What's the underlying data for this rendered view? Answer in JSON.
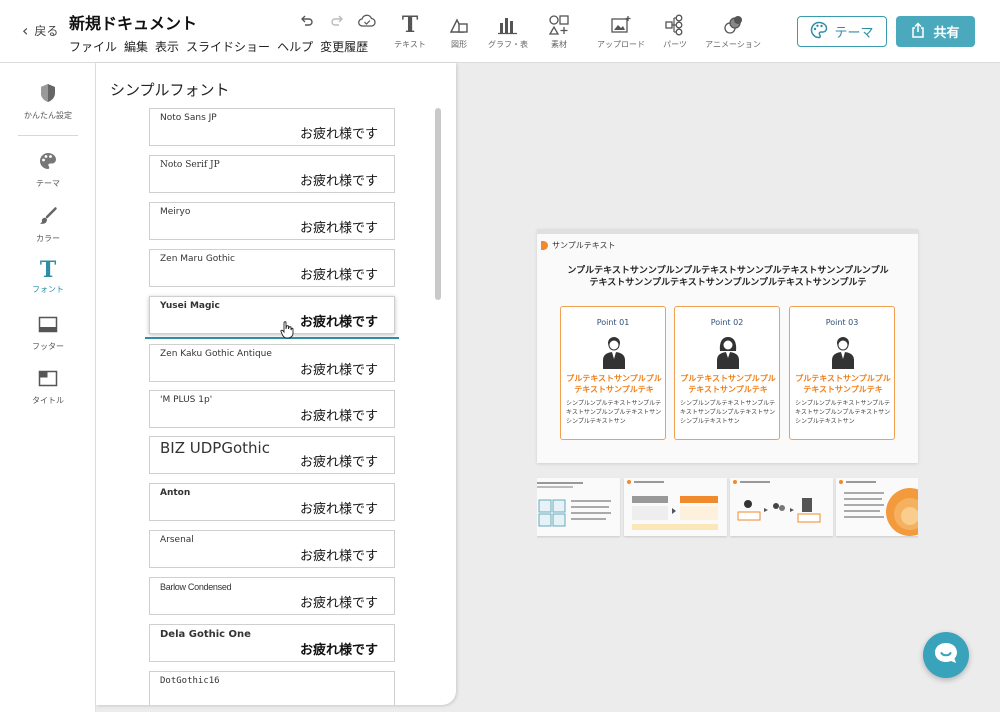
{
  "header": {
    "back_label": "戻る",
    "doc_title": "新規ドキュメント",
    "menu": [
      "ファイル",
      "編集",
      "表示",
      "スライドショー",
      "ヘルプ",
      "変更履歴"
    ],
    "tools": [
      {
        "label": "テキスト",
        "icon": "text-icon"
      },
      {
        "label": "図形",
        "icon": "shapes-icon"
      },
      {
        "label": "グラフ・表",
        "icon": "chart-icon"
      },
      {
        "label": "素材",
        "icon": "assets-icon"
      },
      {
        "label": "アップロード",
        "icon": "upload-icon"
      },
      {
        "label": "パーツ",
        "icon": "parts-icon"
      },
      {
        "label": "アニメーション",
        "icon": "animation-icon"
      }
    ],
    "theme_button": "テーマ",
    "share_button": "共有"
  },
  "sidebar": {
    "items": [
      {
        "label": "かんたん設定",
        "icon": "shield-icon"
      },
      {
        "label": "テーマ",
        "icon": "palette-icon"
      },
      {
        "label": "カラー",
        "icon": "brush-icon"
      },
      {
        "label": "フォント",
        "icon": "font-icon",
        "active": true
      },
      {
        "label": "フッター",
        "icon": "footer-icon"
      },
      {
        "label": "タイトル",
        "icon": "title-layout-icon"
      }
    ]
  },
  "font_panel": {
    "title": "シンプルフォント",
    "sample_text": "お疲れ様です",
    "fonts": [
      {
        "name": "Noto Sans JP"
      },
      {
        "name": "Noto Serif JP"
      },
      {
        "name": "Meiryo"
      },
      {
        "name": "Zen Maru Gothic"
      },
      {
        "name": "Yusei Magic"
      },
      {
        "name": "Zen Kaku Gothic Antique"
      },
      {
        "name": "'M PLUS 1p'"
      },
      {
        "name": "BIZ UDPGothic"
      },
      {
        "name": "Anton"
      },
      {
        "name": "Arsenal"
      },
      {
        "name": "Barlow Condensed"
      },
      {
        "name": "Dela Gothic One"
      },
      {
        "name": "DotGothic16"
      }
    ]
  },
  "slide": {
    "tag": "サンプルテキスト",
    "heading": "ンプルテキストサンンプルンプルテキストサンンプルテキストサンンプルンプルテキストサンンプルテキストサンンプルンプルテキストサンンプルテ",
    "cards": [
      {
        "point": "Point 01",
        "title": "プルテキストサンプルプルテキストサンプルテキ",
        "body": "シンプルンプルテキストサンプルテキストサンプルンプルテキストサンシンプルテキストサン"
      },
      {
        "point": "Point 02",
        "title": "プルテキストサンプルプルテキストサンプルテキ",
        "body": "シンプルンプルテキストサンプルテキストサンプルンプルテキストサンシンプルテキストサン"
      },
      {
        "point": "Point 03",
        "title": "プルテキストサンプルプルテキストサンプルテキ",
        "body": "シンプルンプルテキストサンプルテキストサンプルンプルテキストサンシンプルテキストサン"
      }
    ]
  },
  "colors": {
    "accent": "#2f8ea3",
    "share_bg": "#4aa9bc",
    "slide_orange": "#ef7f1a"
  }
}
